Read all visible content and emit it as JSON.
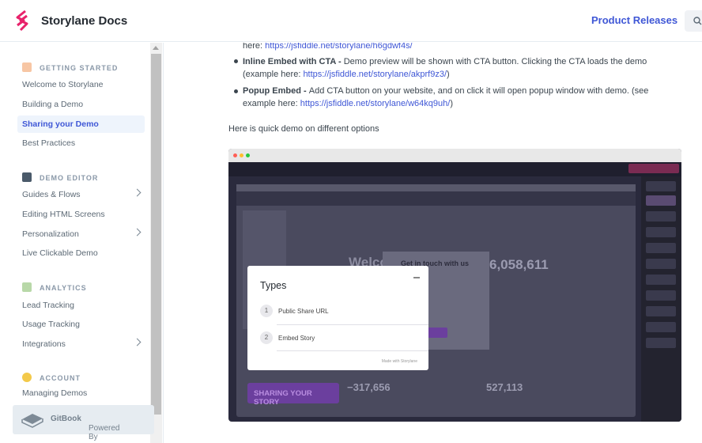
{
  "header": {
    "brand": "Storylane Docs",
    "product_releases": "Product Releases",
    "brand_color": "#e8226b",
    "accent_color": "#3f57d6"
  },
  "sidebar": {
    "sections": [
      {
        "title": "GETTING STARTED",
        "icon": "rocket-icon"
      },
      {
        "title": "DEMO EDITOR",
        "icon": "computer-icon"
      },
      {
        "title": "ANALYTICS",
        "icon": "chart-icon"
      },
      {
        "title": "ACCOUNT",
        "icon": "face-icon"
      }
    ],
    "items": [
      {
        "label": "Welcome to Storylane"
      },
      {
        "label": "Building a Demo"
      },
      {
        "label": "Sharing your Demo"
      },
      {
        "label": "Best Practices"
      },
      {
        "label": "Guides & Flows"
      },
      {
        "label": "Editing HTML Screens"
      },
      {
        "label": "Personalization"
      },
      {
        "label": "Live Clickable Demo"
      },
      {
        "label": "Lead Tracking"
      },
      {
        "label": "Usage Tracking"
      },
      {
        "label": "Integrations"
      },
      {
        "label": "Managing Demos"
      }
    ],
    "powered_prefix": "Powered By ",
    "powered_brand": "GitBook"
  },
  "content": {
    "line0_prefix": "here: ",
    "line0_link": "https://jsfiddle.net/storylane/h6gdwf4s/",
    "bullet1_bold": "Inline Embed with CTA - ",
    "bullet1_text": " Demo preview will be shown with CTA button. Clicking the CTA loads the demo",
    "bullet1_text2": "(example here: ",
    "bullet1_link": "https://jsfiddle.net/storylane/akprf9z3/",
    "bullet1_close": ")",
    "bullet2_bold": "Popup Embed - ",
    "bullet2_text": " Add CTA button on your website, and on click it will open popup window with demo.  (see",
    "bullet2_text2": "example here: ",
    "bullet2_link": "https://jsfiddle.net/storylane/w64kq9uh/",
    "bullet2_close": ")",
    "intro": "Here is quick demo on different options"
  },
  "demo": {
    "popup_title": "Types",
    "options": [
      {
        "num": "1",
        "label": "Public Share URL"
      },
      {
        "num": "2",
        "label": "Embed Story"
      }
    ],
    "share_button": "SHARING YOUR STORY",
    "welcome": "Welco",
    "get_in_touch": "Get in touch with us",
    "stat1": "6,058,611",
    "stat2": "−317,656",
    "stat3": "527,113",
    "made_with": "Made with Storylane"
  }
}
